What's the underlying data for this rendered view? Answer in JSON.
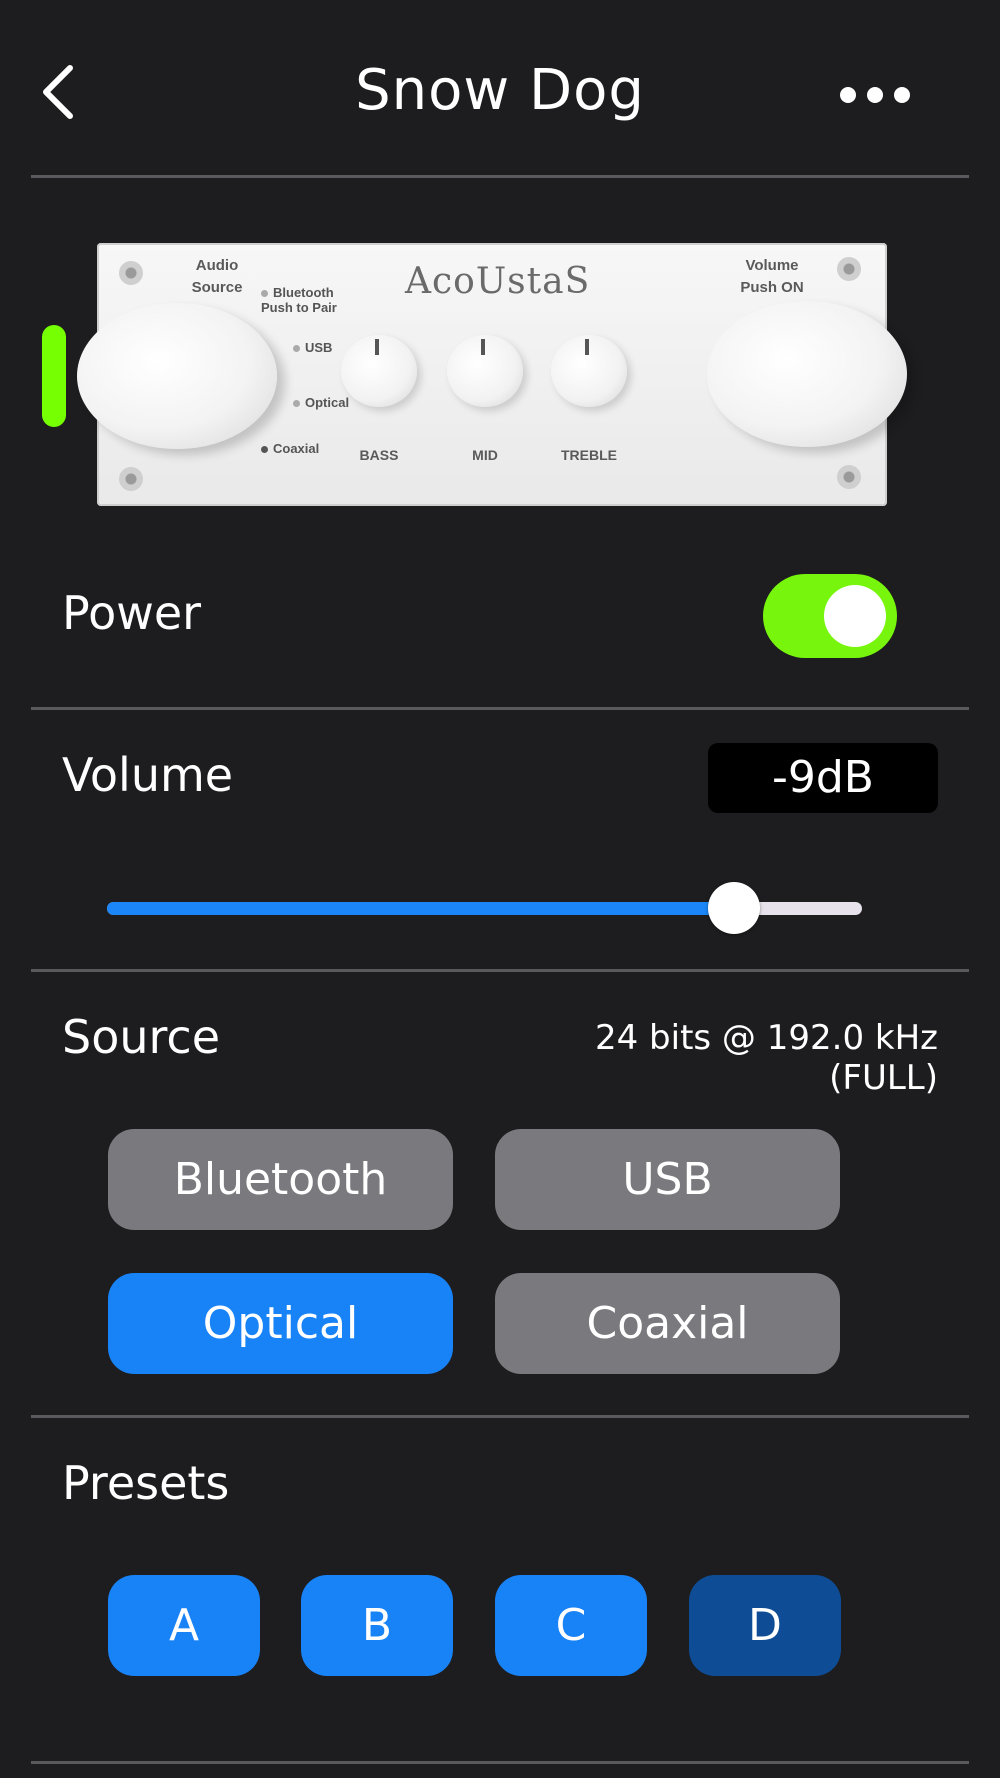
{
  "header": {
    "title": "Snow Dog"
  },
  "device": {
    "brand": "AcoUstaS",
    "audio_source_label": "Audio\nSource",
    "volume_label": "Volume\nPush ON",
    "inputs": [
      "Bluetooth Push to Pair",
      "USB",
      "Optical",
      "Coaxial"
    ],
    "knobs": [
      "BASS",
      "MID",
      "TREBLE"
    ]
  },
  "power": {
    "label": "Power",
    "on": true
  },
  "volume": {
    "label": "Volume",
    "value": "-9dB",
    "level": 0.83
  },
  "source": {
    "label": "Source",
    "info": "24 bits @ 192.0 kHz (FULL)",
    "options": [
      "Bluetooth",
      "USB",
      "Optical",
      "Coaxial"
    ],
    "selected": "Optical"
  },
  "presets": {
    "label": "Presets",
    "items": [
      "A",
      "B",
      "C",
      "D"
    ]
  },
  "colors": {
    "accent": "#1883f7",
    "power_on": "#77f50c",
    "button_gray": "#7a797e"
  }
}
